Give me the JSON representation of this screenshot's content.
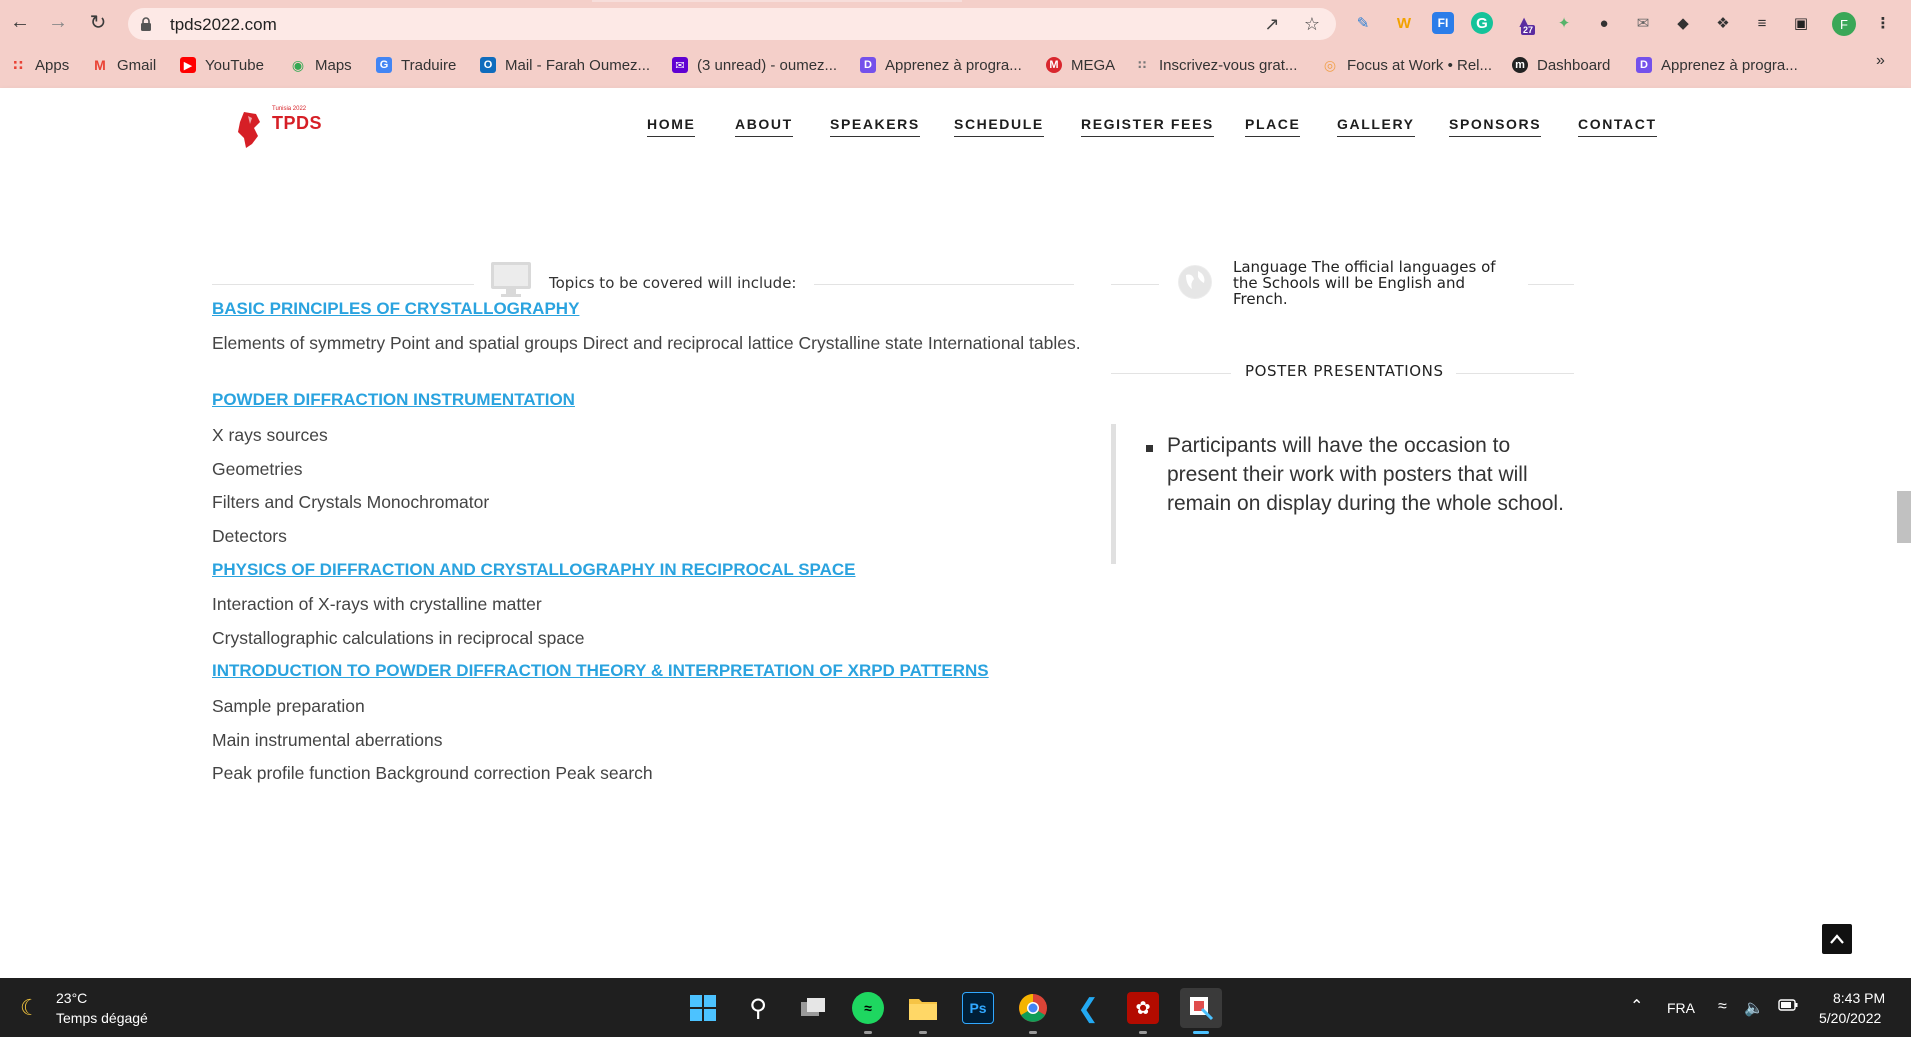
{
  "browser": {
    "url": "tpds2022.com",
    "bookmarks": [
      {
        "label": "Apps",
        "icon": "apps-grid-icon",
        "color": "#e94235"
      },
      {
        "label": "Gmail",
        "icon": "gmail-icon",
        "color": "#ea4335"
      },
      {
        "label": "YouTube",
        "icon": "youtube-icon",
        "color": "#ff0000"
      },
      {
        "label": "Maps",
        "icon": "maps-pin-icon",
        "color": "#34a853"
      },
      {
        "label": "Traduire",
        "icon": "translate-icon",
        "color": "#4285f4"
      },
      {
        "label": "Mail - Farah Oumez...",
        "icon": "outlook-icon",
        "color": "#0f6cbd"
      },
      {
        "label": "(3 unread) - oumez...",
        "icon": "yahoo-mail-icon",
        "color": "#6001d2"
      },
      {
        "label": "Apprenez à progra...",
        "icon": "openclassrooms-icon",
        "color": "#7451eb"
      },
      {
        "label": "MEGA",
        "icon": "mega-icon",
        "color": "#d9272e"
      },
      {
        "label": "Inscrivez-vous grat...",
        "icon": "grid-dots-icon",
        "color": "#777777"
      },
      {
        "label": "Focus at Work • Rel...",
        "icon": "focus-icon",
        "color": "#f0a04b"
      },
      {
        "label": "Dashboard",
        "icon": "m-logo-icon",
        "color": "#222222"
      },
      {
        "label": "Apprenez à progra...",
        "icon": "openclassrooms-icon",
        "color": "#7451eb"
      }
    ],
    "more_label": "»",
    "profile_initial": "F",
    "extension_badge": "27"
  },
  "site": {
    "logo_text": "TPDS",
    "logo_small": "Tunisia 2022",
    "nav": [
      "HOME",
      "ABOUT",
      "SPEAKERS",
      "SCHEDULE",
      "REGISTER FEES",
      "PLACE",
      "GALLERY",
      "SPONSORS",
      "CONTACT"
    ]
  },
  "content": {
    "topics_heading": "Topics to be covered will include:",
    "language_text": "Language The official languages of the Schools will be English and French.",
    "poster_title": "POSTER PRESENTATIONS",
    "poster_text": "Participants will have the occasion to present their work with posters that will remain on display during the whole school.",
    "sections": [
      {
        "title": "BASIC PRINCIPLES OF CRYSTALLOGRAPHY",
        "items": [
          "Elements of symmetry Point and spatial groups Direct and reciprocal lattice Crystalline state International tables."
        ]
      },
      {
        "title": "POWDER DIFFRACTION INSTRUMENTATION",
        "items": [
          "X rays sources",
          "Geometries",
          "Filters and Crystals Monochromator",
          "Detectors"
        ]
      },
      {
        "title": "PHYSICS OF DIFFRACTION AND CRYSTALLOGRAPHY IN RECIPROCAL SPACE",
        "items": [
          "Interaction of X-rays with crystalline matter",
          "Crystallographic calculations in reciprocal space"
        ]
      },
      {
        "title": "INTRODUCTION TO POWDER DIFFRACTION THEORY & INTERPRETATION OF XRPD PATTERNS",
        "items": [
          "Sample preparation",
          "Main instrumental aberrations",
          "Peak profile function Background correction Peak search"
        ]
      }
    ]
  },
  "taskbar": {
    "temperature": "23°C",
    "weather": "Temps dégagé",
    "language": "FRA",
    "time": "8:43 PM",
    "date": "5/20/2022"
  },
  "colors": {
    "chrome_bg": "#f4cfc9",
    "link": "#2aa3df",
    "logo_red": "#d61f26"
  }
}
